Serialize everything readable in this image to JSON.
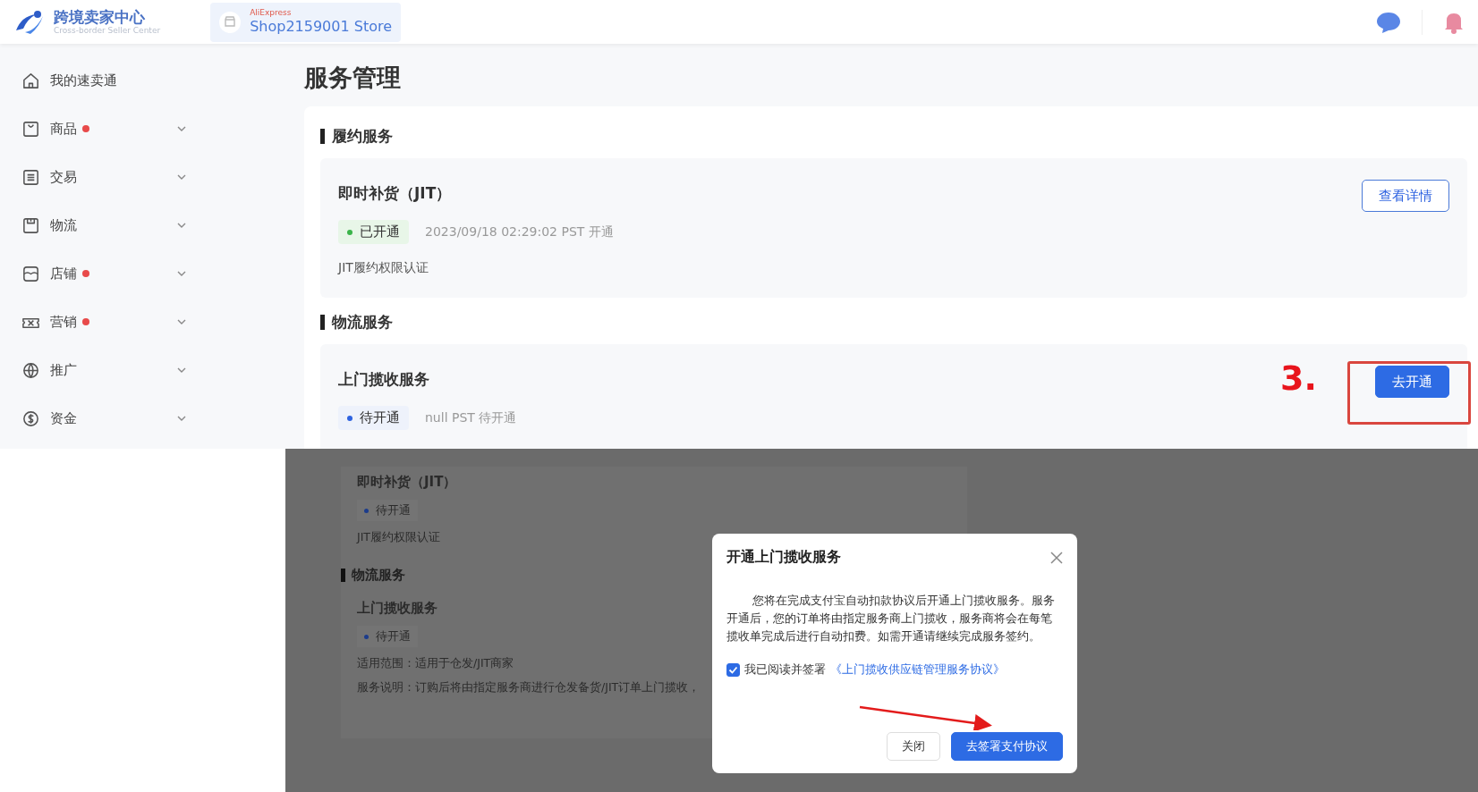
{
  "header": {
    "logo_title": "跨境卖家中心",
    "logo_subtitle": "Cross-border Seller Center",
    "store_brand": "AliExpress",
    "store_name": "Shop2159001 Store"
  },
  "sidebar": {
    "items": [
      {
        "label": "我的速卖通",
        "dot": false,
        "expandable": false
      },
      {
        "label": "商品",
        "dot": true,
        "expandable": true
      },
      {
        "label": "交易",
        "dot": false,
        "expandable": true
      },
      {
        "label": "物流",
        "dot": false,
        "expandable": true
      },
      {
        "label": "店铺",
        "dot": true,
        "expandable": true
      },
      {
        "label": "营销",
        "dot": true,
        "expandable": true
      },
      {
        "label": "推广",
        "dot": false,
        "expandable": true
      },
      {
        "label": "资金",
        "dot": false,
        "expandable": true
      }
    ]
  },
  "page_title": "服务管理",
  "sections": [
    {
      "heading": "履约服务",
      "services": [
        {
          "name": "即时补货（JIT）",
          "status": {
            "label": "已开通",
            "kind": "active"
          },
          "meta": "2023/09/18 02:29:02 PST 开通",
          "lines": [
            "JIT履约权限认证"
          ],
          "button": {
            "label": "查看详情",
            "kind": "outline",
            "highlighted": false
          }
        }
      ]
    },
    {
      "heading": "物流服务",
      "services": [
        {
          "name": "上门揽收服务",
          "status": {
            "label": "待开通",
            "kind": "pending"
          },
          "meta": "null PST 待开通",
          "button": {
            "label": "去开通",
            "kind": "primary",
            "highlighted": true
          }
        }
      ]
    }
  ],
  "step_label": "3.",
  "background_page": {
    "items": [
      {
        "kind": "service",
        "name": "即时补货（JIT）",
        "status": {
          "label": "待开通",
          "kind": "pending"
        },
        "lines": [
          "JIT履约权限认证"
        ]
      },
      {
        "kind": "heading",
        "text": "物流服务"
      },
      {
        "kind": "service",
        "name": "上门揽收服务",
        "status": {
          "label": "待开通",
          "kind": "pending"
        },
        "lines": [
          "适用范围：适用于仓发/JIT商家",
          "服务说明：订购后将由指定服务商进行仓发备货/JIT订单上门揽收，"
        ]
      }
    ]
  },
  "dialog": {
    "title": "开通上门揽收服务",
    "body": "您将在完成支付宝自动扣款协议后开通上门揽收服务。服务开通后，您的订单将由指定服务商上门揽收，服务商将会在每笔揽收单完成后进行自动扣费。如需开通请继续完成服务签约。",
    "agree": {
      "checked": true,
      "label": "我已阅读并签署",
      "link": "《上门揽收供应链管理服务协议》"
    },
    "buttons": [
      {
        "label": "关闭",
        "kind": "default"
      },
      {
        "label": "去签署支付协议",
        "kind": "primary"
      }
    ]
  }
}
